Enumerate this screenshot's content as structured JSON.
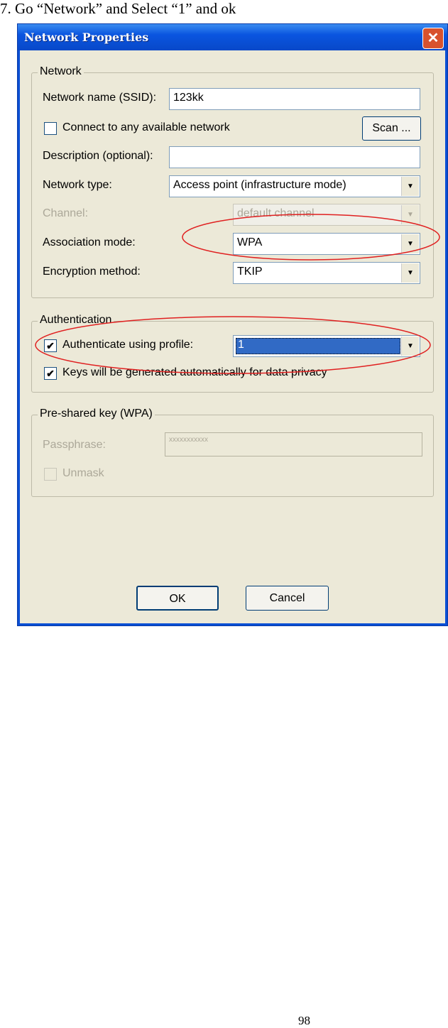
{
  "caption": "7. Go “Network” and Select “1” and ok",
  "page_number": "98",
  "dialog": {
    "title": "Network Properties",
    "close_icon": "close-icon",
    "network_group": {
      "label": "Network",
      "ssid_label": "Network name (SSID):",
      "ssid_value": "123kk",
      "connect_any_label": "Connect to any available network",
      "connect_any_checked": false,
      "scan_label": "Scan ...",
      "description_label": "Description (optional):",
      "description_value": "",
      "network_type_label": "Network type:",
      "network_type_value": "Access point (infrastructure mode)",
      "channel_label": "Channel:",
      "channel_value": "default channel",
      "association_label": "Association mode:",
      "association_value": "WPA",
      "encryption_label": "Encryption method:",
      "encryption_value": "TKIP"
    },
    "auth_group": {
      "label": "Authentication",
      "auth_profile_label": "Authenticate using profile:",
      "auth_profile_checked": true,
      "auth_profile_value": "1",
      "keys_auto_label": "Keys will be generated automatically for data privacy",
      "keys_auto_checked": true
    },
    "psk_group": {
      "label": "Pre-shared key (WPA)",
      "passphrase_label": "Passphrase:",
      "passphrase_value": "xxxxxxxxxxx",
      "unmask_label": "Unmask",
      "unmask_checked": false
    },
    "ok_label": "OK",
    "cancel_label": "Cancel",
    "highlight_color": "#e02020",
    "selection_color": "#316ac5"
  }
}
